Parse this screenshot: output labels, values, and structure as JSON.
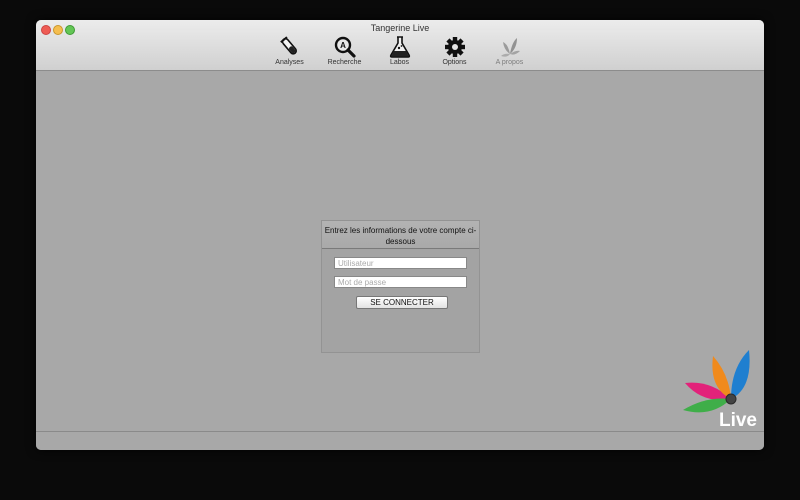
{
  "window": {
    "title": "Tangerine Live"
  },
  "toolbar": {
    "items": [
      {
        "label": "Analyses",
        "icon": "test-tube-icon"
      },
      {
        "label": "Recherche",
        "icon": "magnifier-icon"
      },
      {
        "label": "Labos",
        "icon": "flask-icon"
      },
      {
        "label": "Options",
        "icon": "gear-icon"
      },
      {
        "label": "A propos",
        "icon": "leaf-icon"
      }
    ]
  },
  "login": {
    "heading": "Entrez les informations de votre compte ci-dessous",
    "username_placeholder": "Utilisateur",
    "password_placeholder": "Mot de passe",
    "submit_label": "SE CONNECTER"
  },
  "logo": {
    "text": "Live",
    "colors": [
      "#e2227a",
      "#f08a1c",
      "#1f7fd0",
      "#3fae49"
    ]
  }
}
